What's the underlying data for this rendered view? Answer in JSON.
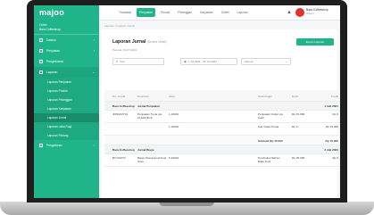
{
  "app": {
    "logo": "majoo",
    "nav": [
      "Transaksi",
      "Penjualan",
      "Produk",
      "Pelanggan",
      "Karyawan",
      "Outlet",
      "Laporan"
    ],
    "user": {
      "name": "Bara Coffeeshop",
      "role": "Owner"
    },
    "avatar_color": "#e0342f"
  },
  "sidebar": {
    "outlet_label": "Outlet",
    "outlet_name": "Bara Coffeeshop",
    "items": [
      {
        "label": "Dasbor"
      },
      {
        "label": "Penjualan"
      },
      {
        "label": "Pengeluaran"
      },
      {
        "label": "Laporan"
      }
    ],
    "sub_items": [
      "Laporan Penjualan",
      "Laporan Produk",
      "Laporan Pelanggan",
      "Laporan Karyawan",
      "Laporan Jurnal",
      "Laporan Laba Rugi",
      "Laporan Piutang"
    ],
    "active_sub": "Laporan Jurnal",
    "bottom_item": "Pengaturan",
    "accent": "#1fb48a"
  },
  "main": {
    "breadcrumb": "Laporan / Laporan Jurnal",
    "title": "Laporan Jurnal",
    "title_note": "(Semua Outlet)",
    "subtitle": "Periode: 01-07-2021",
    "export_label": "Export Laporan",
    "search_placeholder": "Cari",
    "date_range": "1 Jul 2021 - 31 Jul 2021",
    "select_value": "Semua"
  },
  "table": {
    "headers": [
      "No. Jurnal",
      "Deskripsi",
      "Akun",
      "",
      "Keterangan",
      "Debit",
      "Kredit"
    ],
    "groups": [
      {
        "outlet": "Bara Coffeeshop",
        "desc": "Jurnal Penjualan",
        "date": "1 Juli 2021",
        "rows": [
          {
            "no": "JRN/210701",
            "desc": "Penjualan Tunai via FLAZZ BCA",
            "akun": "1-10001",
            "ket": "Penjualan Outlet via Kasir",
            "debit": "Rp 15.000",
            "kredit": "Rp 0"
          },
          {
            "no": "",
            "desc": "",
            "akun": "1-10002",
            "ket": "Kas Outlet Pusat",
            "debit": "Rp 0",
            "kredit": "Rp 15.000"
          }
        ],
        "subtotal_label": "Subtotal Rp 15.000",
        "subtotal_value": "Rp 15.000"
      },
      {
        "outlet": "Bara Coffeeshop",
        "desc": "Jurnal Biaya",
        "date": "2 Juli 2021",
        "rows": [
          {
            "no": "BIY/21070",
            "desc": "Biaya Operasional Kopi Susu",
            "akun": "5-10001",
            "ket": "Pembelian Bahan Baku Kopi",
            "debit": "Rp 25.000",
            "kredit": "Rp 0"
          }
        ]
      }
    ]
  }
}
